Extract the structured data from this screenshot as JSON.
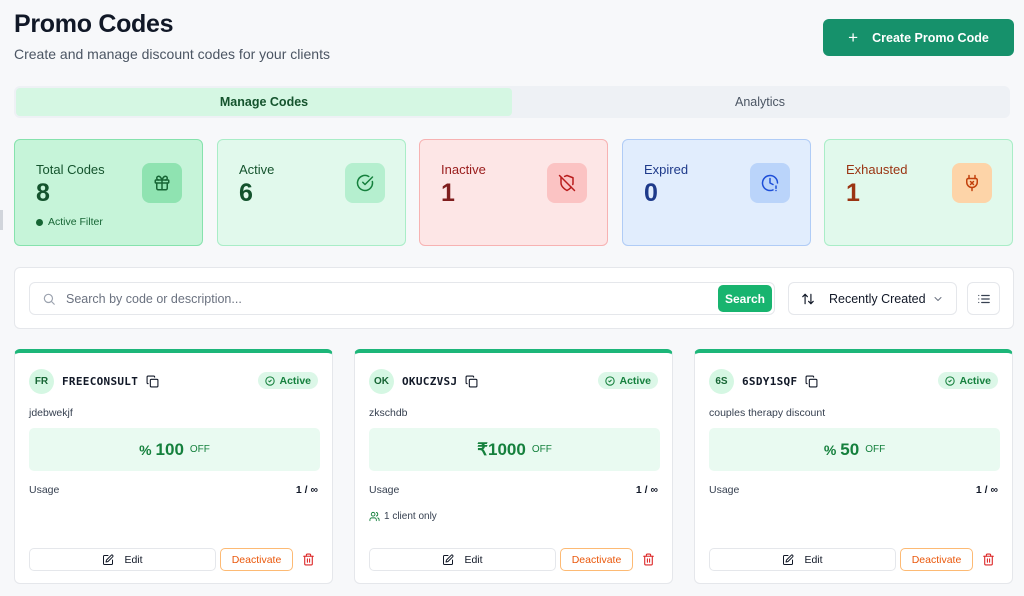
{
  "header": {
    "title": "Promo Codes",
    "subtitle": "Create and manage discount codes for your clients",
    "create_label": "Create Promo Code"
  },
  "tabs": [
    {
      "label": "Manage Codes",
      "active": true
    },
    {
      "label": "Analytics",
      "active": false
    }
  ],
  "stats": {
    "total": {
      "label": "Total Codes",
      "value": "8",
      "filter": "Active Filter",
      "icon": "gift-icon"
    },
    "active": {
      "label": "Active",
      "value": "6",
      "icon": "check-circle-icon"
    },
    "inactive": {
      "label": "Inactive",
      "value": "1",
      "icon": "shield-off-icon"
    },
    "expired": {
      "label": "Expired",
      "value": "0",
      "icon": "clock-alert-icon"
    },
    "exhausted": {
      "label": "Exhausted",
      "value": "1",
      "icon": "exhausted-icon"
    }
  },
  "toolbar": {
    "search_placeholder": "Search by code or description...",
    "search_value": "",
    "search_button": "Search",
    "sort_label": "Recently Created"
  },
  "cards": [
    {
      "initials": "FR",
      "code": "FREECONSULT",
      "status": "Active",
      "description": "jdebwekjf",
      "discount_symbol": "%",
      "discount_amount": "100",
      "discount_suffix": "OFF",
      "usage_label": "Usage",
      "usage_value": "1 / ∞",
      "restriction": "",
      "edit_label": "Edit",
      "deactivate_label": "Deactivate"
    },
    {
      "initials": "OK",
      "code": "OKUCZVSJ",
      "status": "Active",
      "description": "zkschdb",
      "discount_symbol": "₹",
      "discount_amount": "1000",
      "discount_suffix": "OFF",
      "usage_label": "Usage",
      "usage_value": "1 / ∞",
      "restriction": "1 client only",
      "edit_label": "Edit",
      "deactivate_label": "Deactivate"
    },
    {
      "initials": "6S",
      "code": "6SDY1SQF",
      "status": "Active",
      "description": "couples therapy discount",
      "discount_symbol": "%",
      "discount_amount": "50",
      "discount_suffix": "OFF",
      "usage_label": "Usage",
      "usage_value": "1 / ∞",
      "restriction": "",
      "edit_label": "Edit",
      "deactivate_label": "Deactivate"
    }
  ],
  "colors": {
    "primary": "#16916b",
    "accent": "#18b46f",
    "danger": "#dc2626",
    "warning": "#ea580c"
  }
}
